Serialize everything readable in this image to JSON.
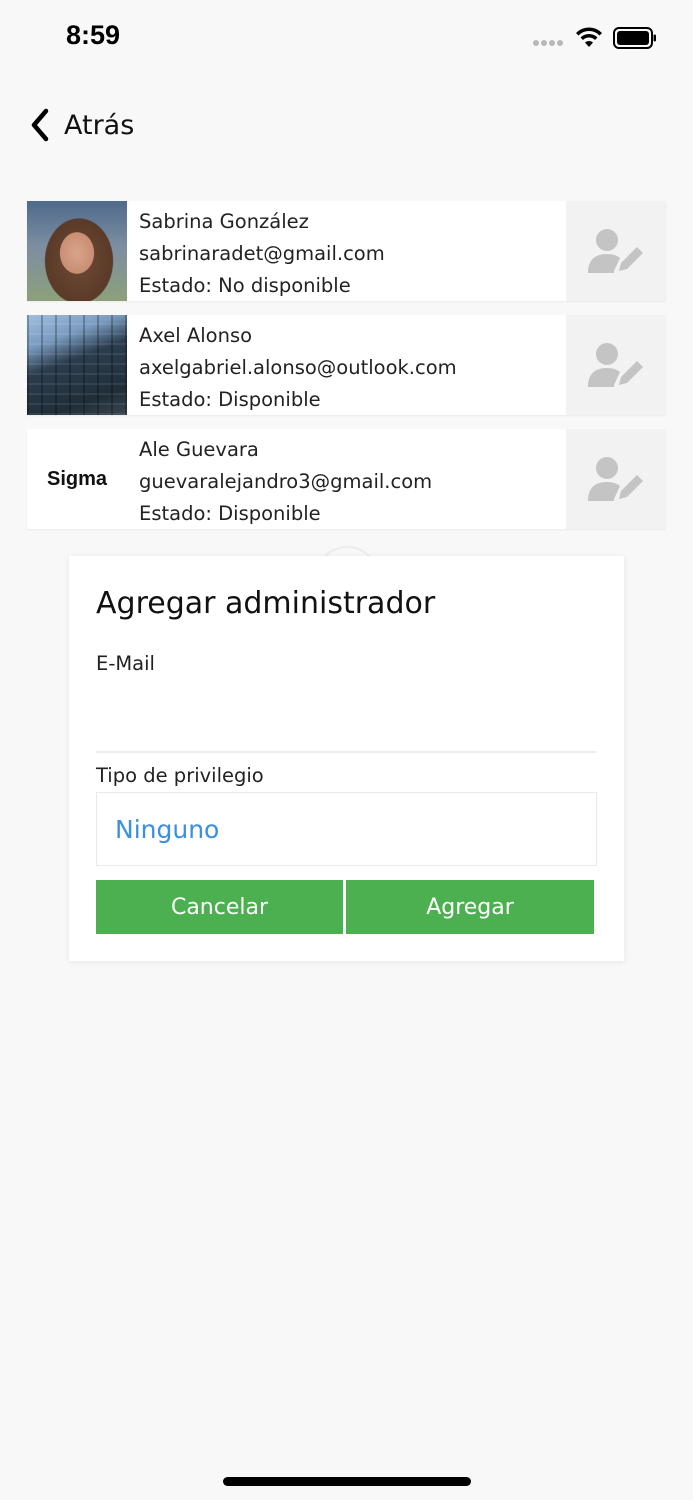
{
  "status_bar": {
    "time": "8:59"
  },
  "nav": {
    "back_label": "Atrás"
  },
  "users": [
    {
      "name": "Sabrina González",
      "email": "sabrinaradet@gmail.com",
      "status": "Estado: No disponible",
      "avatar": "photo-portrait"
    },
    {
      "name": "Axel Alonso",
      "email": "axelgabriel.alonso@outlook.com",
      "status": "Estado: Disponible",
      "avatar": "photo-building"
    },
    {
      "name": "Ale Guevara",
      "email": "guevaralejandro3@gmail.com",
      "status": "Estado: Disponible",
      "avatar": "logo",
      "avatar_logo_text": "Sigma"
    }
  ],
  "dialog": {
    "title": "Agregar administrador",
    "email_label": "E-Mail",
    "email_value": "",
    "privilege_label": "Tipo de privilegio",
    "privilege_value": "Ninguno",
    "cancel_label": "Cancelar",
    "add_label": "Agregar"
  },
  "colors": {
    "accent_green": "#4cb050",
    "link_blue": "#3a8fe0",
    "background": "#f8f8f8",
    "edit_icon_gray": "#c4c4c4"
  },
  "icons": {
    "back": "chevron-left-icon",
    "edit_user": "user-edit-icon"
  }
}
